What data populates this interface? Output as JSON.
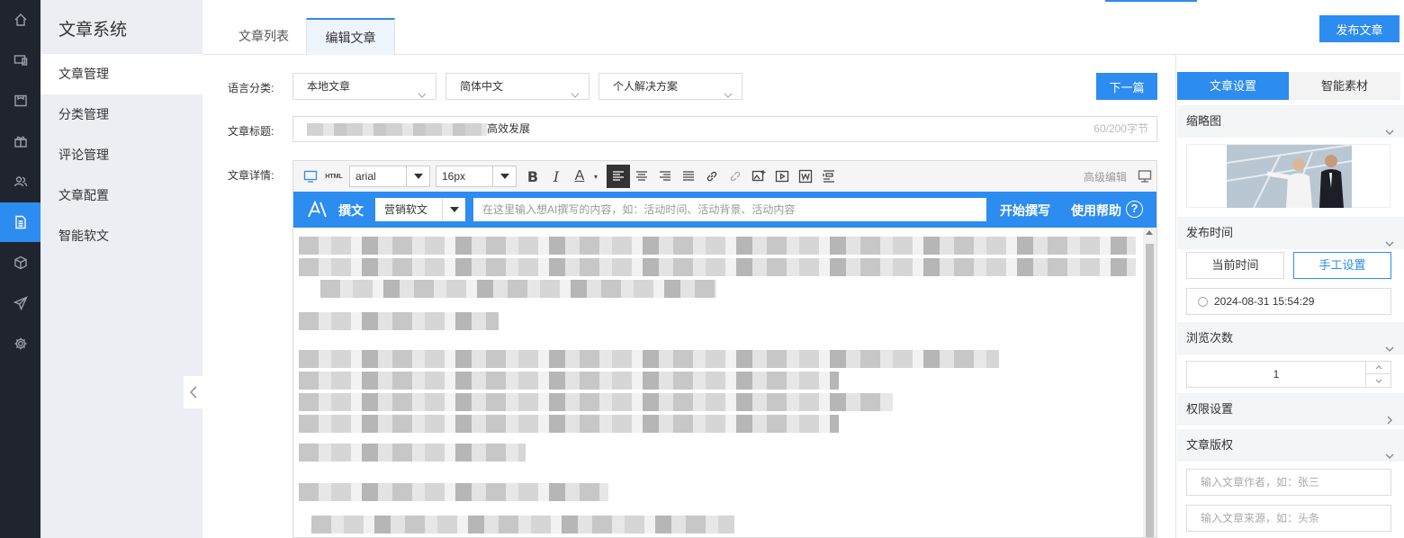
{
  "app": {
    "title": "文章系统",
    "publish_button": "发布文章"
  },
  "sidebar": {
    "icons": [
      "home-icon",
      "monitor-icon",
      "calendar-icon",
      "gift-icon",
      "users-icon",
      "document-icon",
      "box-icon",
      "send-icon",
      "gear-icon"
    ],
    "active_icon": "document-icon"
  },
  "subnav": {
    "items": [
      {
        "label": "文章管理"
      },
      {
        "label": "分类管理"
      },
      {
        "label": "评论管理"
      },
      {
        "label": "文章配置"
      },
      {
        "label": "智能软文"
      }
    ],
    "active_index": 0
  },
  "tabs": [
    {
      "label": "文章列表"
    },
    {
      "label": "编辑文章"
    }
  ],
  "active_tab": 1,
  "form": {
    "language_label": "语言分类:",
    "selects": [
      "本地文章",
      "简体中文",
      "个人解决方案"
    ],
    "next_button": "下一篇",
    "title_label": "文章标题:",
    "title_value_visible": "高效发展",
    "title_count": "60/200字节",
    "detail_label": "文章详情:"
  },
  "editor": {
    "font_family": "arial",
    "font_size": "16px",
    "advanced_label": "高级编辑",
    "html_label": "HTML",
    "ai": {
      "label": "撰文",
      "type": "营销软文",
      "placeholder": "在这里输入想AI撰写的内容，如：活动时间、活动背景、活动内容",
      "start": "开始撰写",
      "help": "使用帮助",
      "help_icon": "?"
    }
  },
  "right_panel": {
    "tabs": [
      "文章设置",
      "智能素材"
    ],
    "thumbnail_label": "缩略图",
    "publish_time_label": "发布时间",
    "current_time_button": "当前时间",
    "manual_button": "手工设置",
    "datetime": "2024-08-31 15:54:29",
    "views_label": "浏览次数",
    "views_value": "1",
    "permission_label": "权限设置",
    "copyright_label": "文章版权",
    "author_placeholder": "输入文章作者，如：张三",
    "source_placeholder": "输入文章来源，如：头条"
  },
  "colors": {
    "accent": "#2d8cf0",
    "rail": "#20242f",
    "subnav_bg": "#eceef4"
  }
}
